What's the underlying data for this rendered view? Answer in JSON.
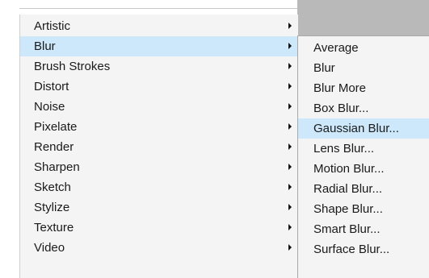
{
  "filter_menu": {
    "items": [
      {
        "label": "Artistic"
      },
      {
        "label": "Blur"
      },
      {
        "label": "Brush Strokes"
      },
      {
        "label": "Distort"
      },
      {
        "label": "Noise"
      },
      {
        "label": "Pixelate"
      },
      {
        "label": "Render"
      },
      {
        "label": "Sharpen"
      },
      {
        "label": "Sketch"
      },
      {
        "label": "Stylize"
      },
      {
        "label": "Texture"
      },
      {
        "label": "Video"
      }
    ],
    "highlighted": "Blur",
    "highlight_color": "#cde8fb"
  },
  "blur_submenu": {
    "items": [
      {
        "label": "Average"
      },
      {
        "label": "Blur"
      },
      {
        "label": "Blur More"
      },
      {
        "label": "Box Blur..."
      },
      {
        "label": "Gaussian Blur..."
      },
      {
        "label": "Lens Blur..."
      },
      {
        "label": "Motion Blur..."
      },
      {
        "label": "Radial Blur..."
      },
      {
        "label": "Shape Blur..."
      },
      {
        "label": "Smart Blur..."
      },
      {
        "label": "Surface Blur..."
      }
    ],
    "highlighted": "Gaussian Blur..."
  }
}
